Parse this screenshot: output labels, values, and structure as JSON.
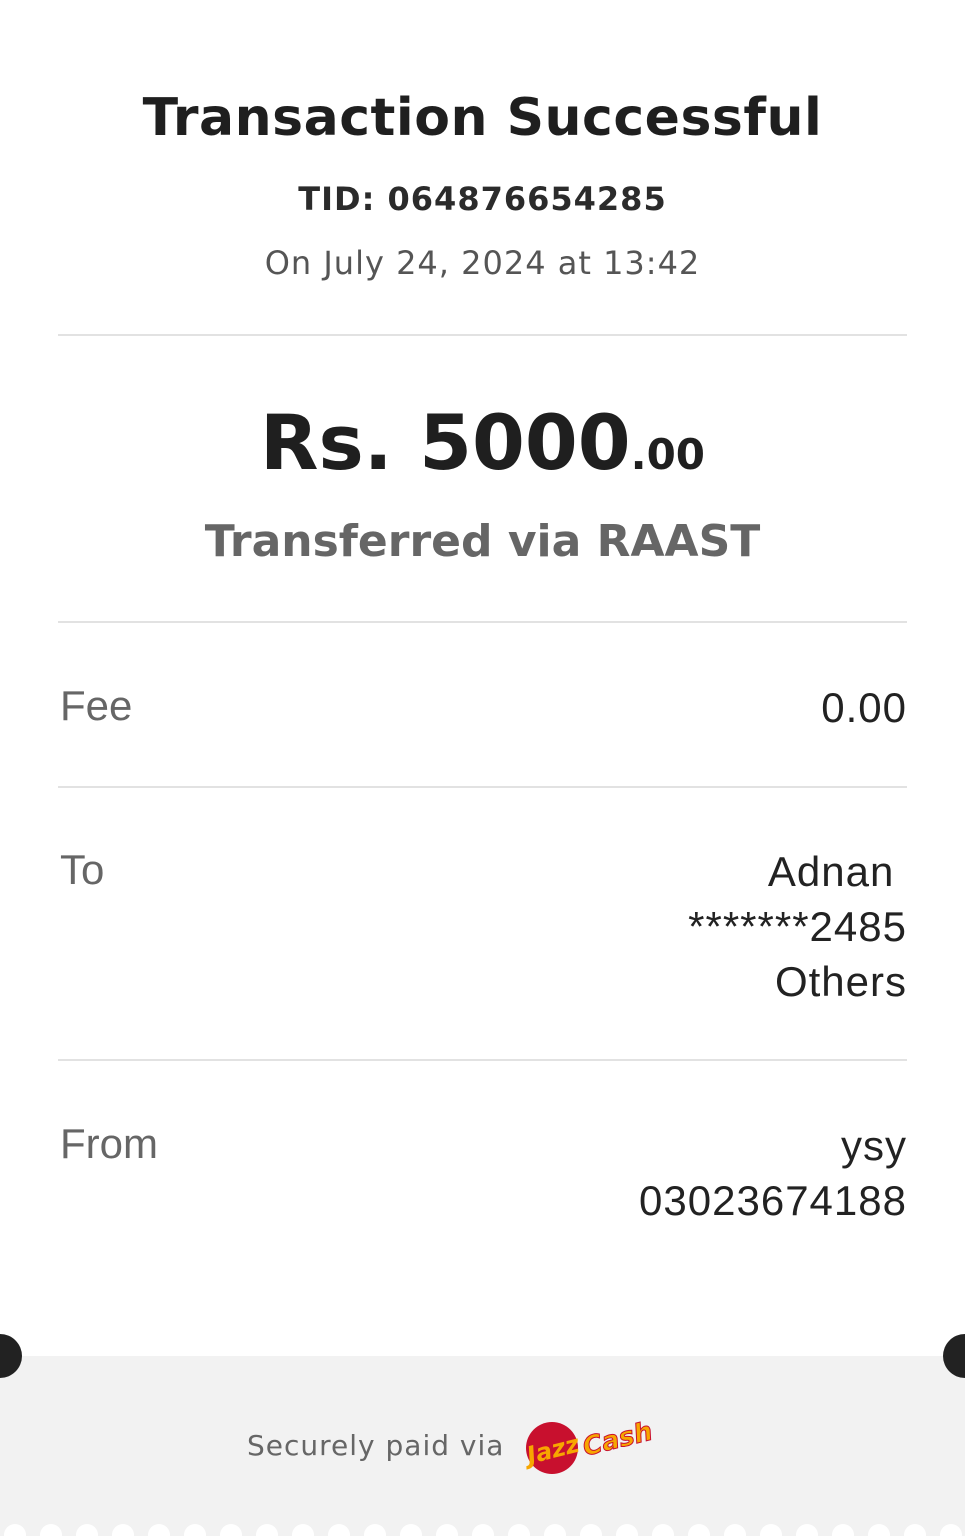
{
  "header": {
    "title": "Transaction Successful",
    "tid": "TID: 064876654285",
    "datetime": "On July 24, 2024 at 13:42"
  },
  "amount": {
    "main": "Rs. 5000",
    "cents": ".00",
    "via": "Transferred via RAAST"
  },
  "fee": {
    "label": "Fee",
    "value": "0.00"
  },
  "to": {
    "label": "To",
    "name": "Adnan ",
    "account": "*******2485",
    "bank": "Others"
  },
  "from": {
    "label": "From",
    "name": "ysy",
    "account": "03023674188"
  },
  "footer": {
    "secure_text": "Securely paid via",
    "logo_text_1": "Jazz",
    "logo_text_2": "Cash",
    "logo_colors": {
      "red": "#c8102e",
      "orange": "#f7a600"
    }
  }
}
